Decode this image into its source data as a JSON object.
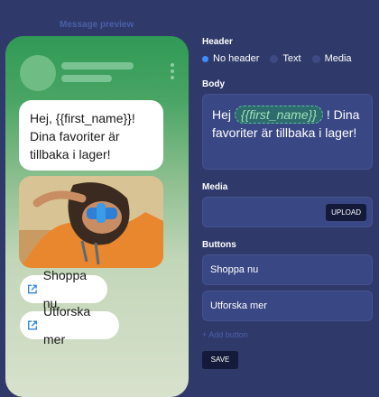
{
  "preview": {
    "title": "Message preview",
    "bubble_text": "Hej, {{first_name}}! Dina favoriter är tillbaka i lager!",
    "buttons": [
      {
        "label": "Shoppa nu",
        "icon": "external-link-icon"
      },
      {
        "label": "Utforska mer",
        "icon": "external-link-icon"
      }
    ]
  },
  "form": {
    "header_label": "Header",
    "header_options": [
      "No header",
      "Text",
      "Media"
    ],
    "header_selected": "No header",
    "body_label": "Body",
    "body_prefix": "Hej ",
    "body_variable": "{{first_name}}",
    "body_suffix": " ! Dina favoriter är tillbaka i lager!",
    "media_label": "Media",
    "upload_label": "UPLOAD",
    "buttons_label": "Buttons",
    "button_values": [
      "Shoppa nu",
      "Utforska mer"
    ],
    "add_button_label": "+ Add button",
    "save_label": "SAVE"
  },
  "colors": {
    "background": "#2f3a6a",
    "accent": "#3d8cff",
    "brand_green": "#2f9a55"
  }
}
